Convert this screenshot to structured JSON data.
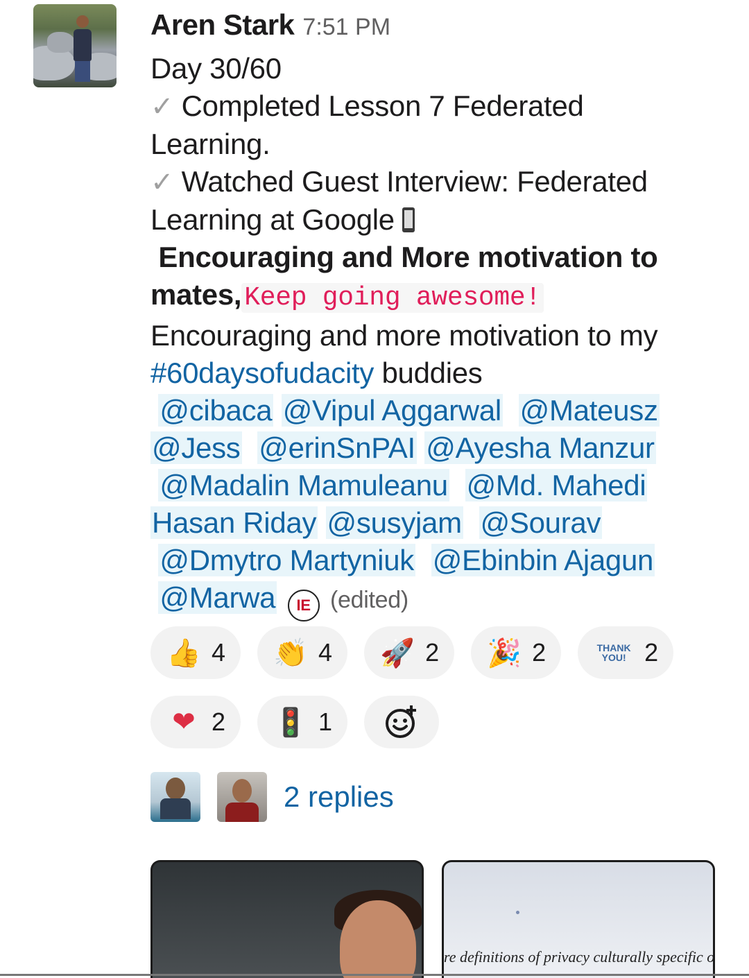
{
  "message": {
    "author": "Aren Stark",
    "time": "7:51 PM",
    "day": "Day 30/60",
    "check_mark": "✓",
    "line_lesson_a": "Completed Lesson 7 Federated",
    "line_lesson_b": "Learning.",
    "line_interview_a": "Watched Guest Interview: Federated",
    "line_interview_b": "Learning at Google",
    "bold_a": "Encouraging and More motivation to",
    "bold_b": "mates,",
    "code_text": "Keep going awesome!",
    "plain_a": "Encouraging and more motivation to my",
    "hashtag": "#60daysofudacity",
    "buddies": "buddies",
    "mentions": [
      "@cibaca",
      "@Vipul Aggarwal",
      "@Mateusz",
      "@Jess",
      "@erinSnPAI",
      "@Ayesha Manzur",
      "@Madalin Mamuleanu",
      "@Md. Mahedi",
      "Hasan Riday",
      "@susyjam",
      "@Sourav",
      "@Dmytro Martyniuk",
      "@Ebinbin Ajagun",
      "@Marwa"
    ],
    "ie_icon_text": "IE",
    "edited": "(edited)"
  },
  "reactions": [
    {
      "icon": "thumbs-up-icon",
      "glyph": "👍",
      "count": "4"
    },
    {
      "icon": "clapping-hands-icon",
      "glyph": "👏",
      "count": "4"
    },
    {
      "icon": "rocket-icon",
      "glyph": "🚀",
      "count": "2"
    },
    {
      "icon": "party-popper-icon",
      "glyph": "🎉",
      "count": "2"
    },
    {
      "icon": "thank-you-icon",
      "glyph_top": "THANK",
      "glyph_bottom": "YOU!",
      "count": "2"
    },
    {
      "icon": "heart-icon",
      "glyph": "❤",
      "count": "2"
    },
    {
      "icon": "launch-icon",
      "glyph": "🚦",
      "count": "1"
    }
  ],
  "add_reaction_icon": "add-reaction-icon",
  "replies": {
    "label": "2 replies"
  },
  "attachments": {
    "caption": "re definitions of privacy culturally specific or"
  }
}
